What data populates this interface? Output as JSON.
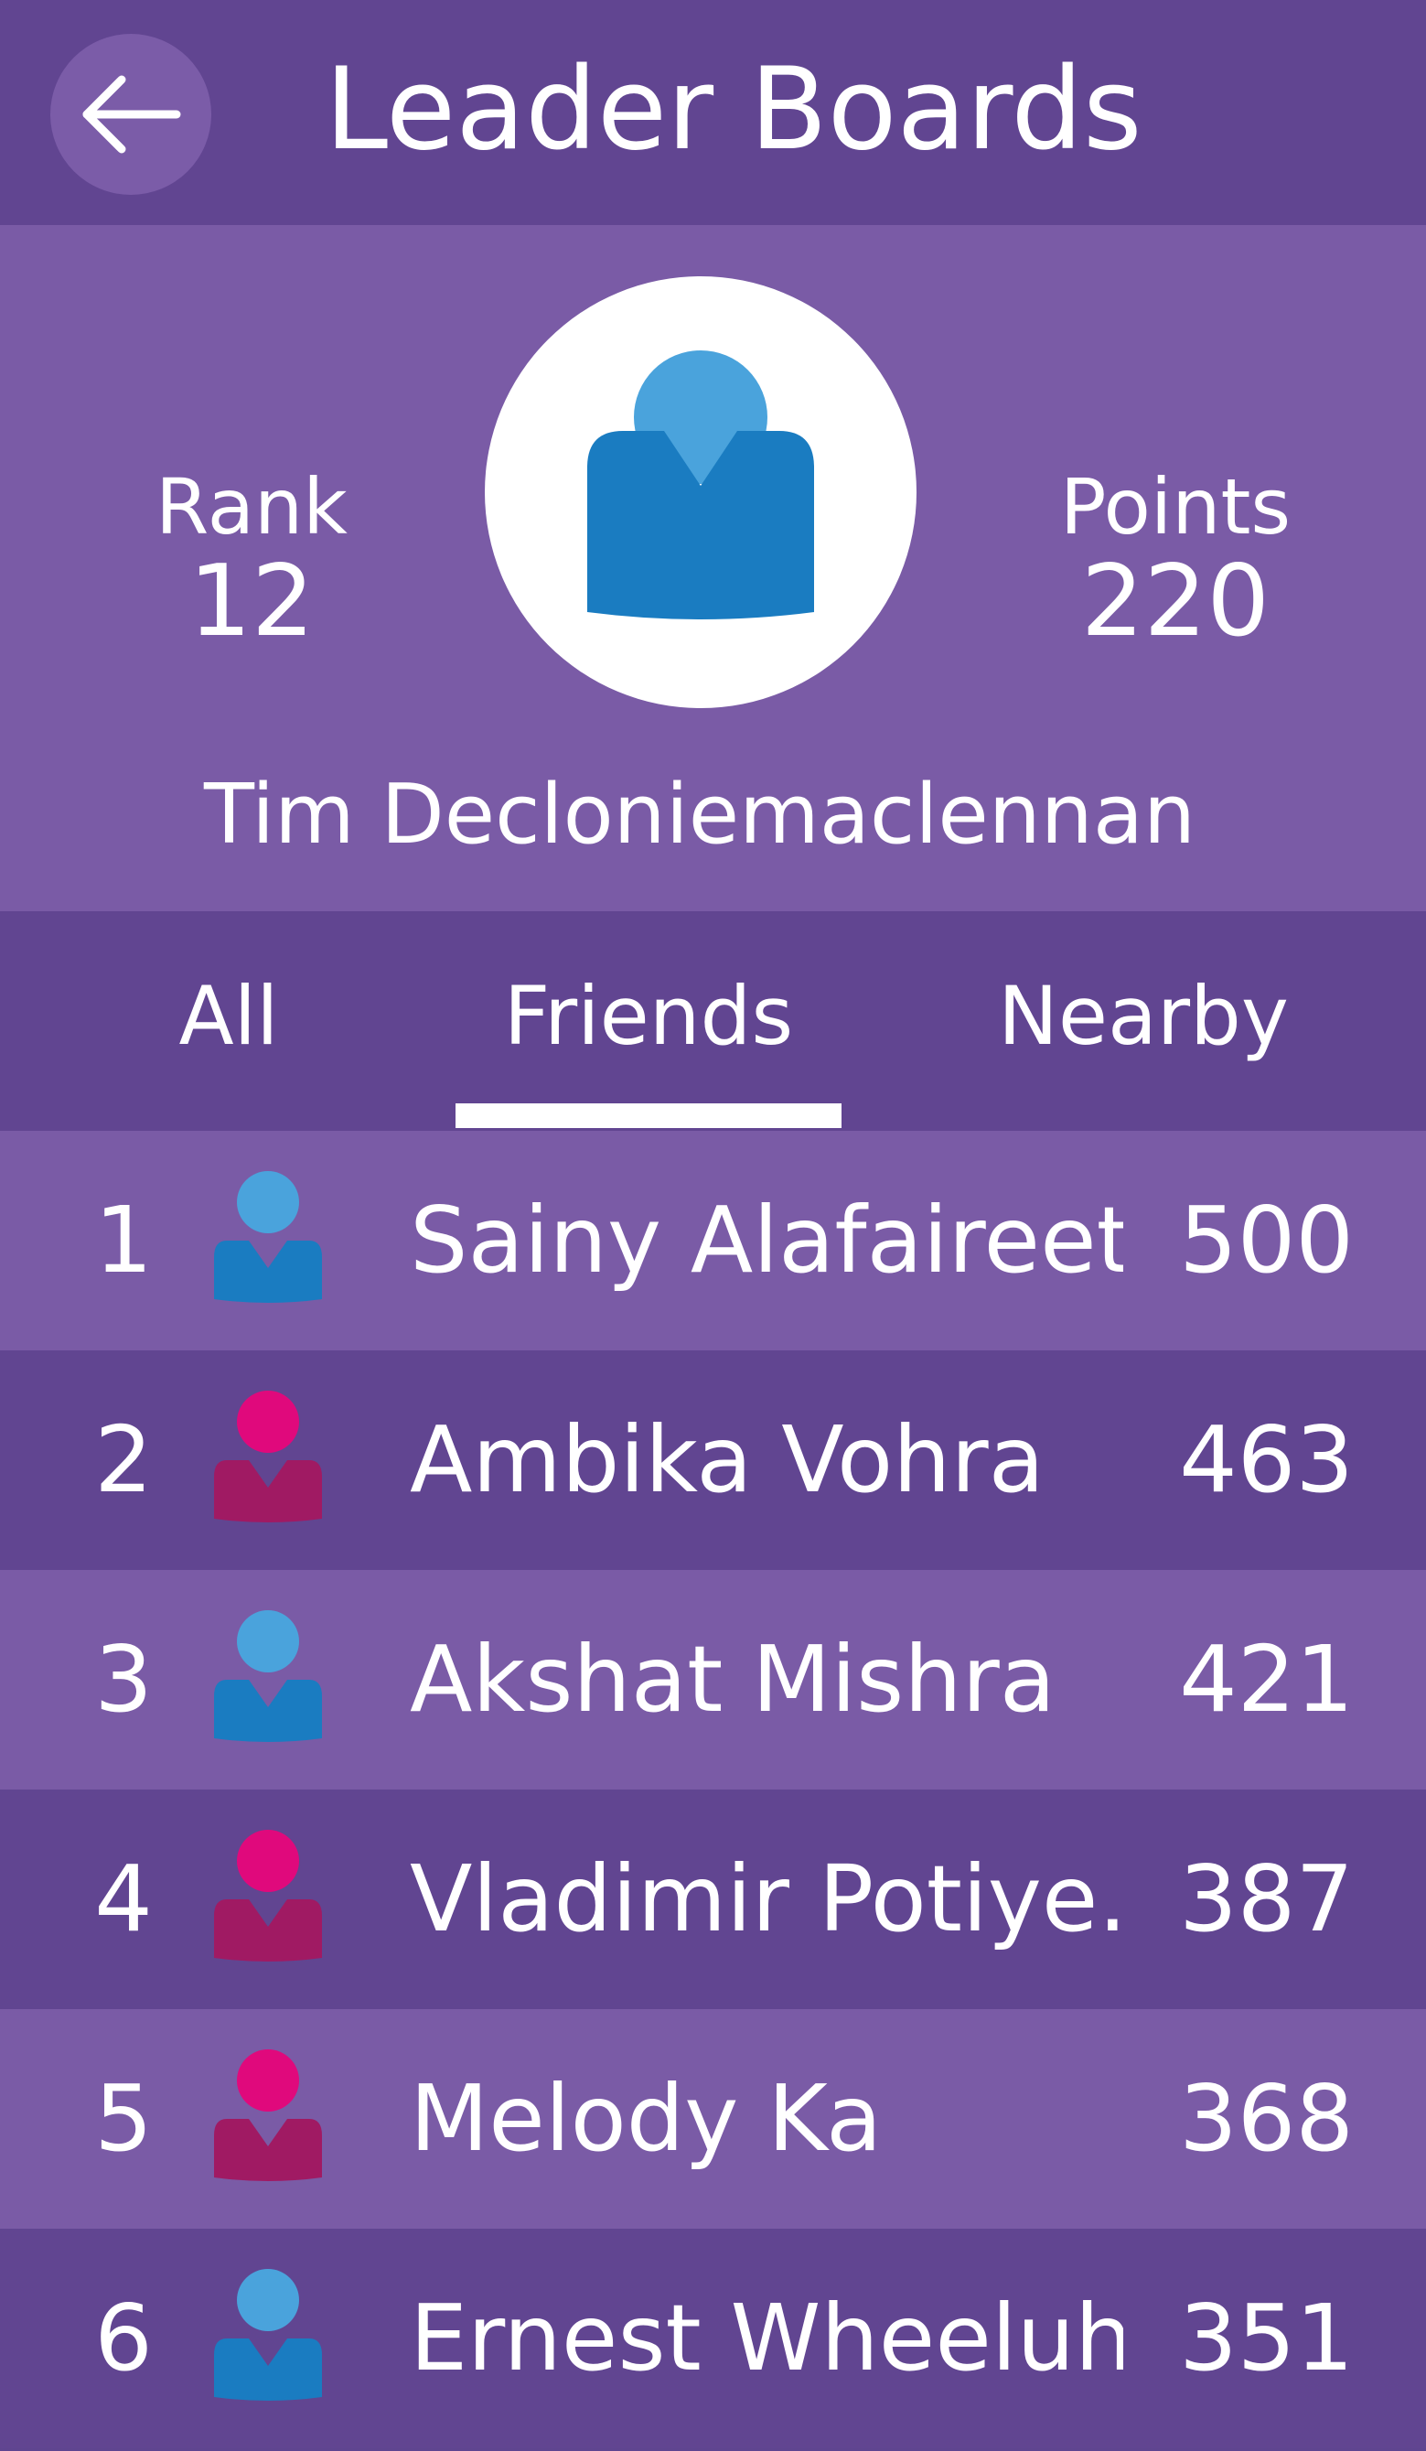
{
  "header": {
    "title": "Leader Boards",
    "back_icon": "arrow-left-icon"
  },
  "profile": {
    "rank_label": "Rank",
    "rank_value": "12",
    "points_label": "Points",
    "points_value": "220",
    "name": "Tim Decloniemaclennan",
    "avatar_icon": "user-avatar-icon",
    "avatar_color": "#1a7cc1"
  },
  "tabs": {
    "items": [
      "All",
      "Friends",
      "Nearby"
    ],
    "selected": "Friends"
  },
  "leaderboard": [
    {
      "rank": "1",
      "name": "Sainy Alafaireet",
      "points": "500",
      "avatar": "blue"
    },
    {
      "rank": "2",
      "name": "Ambika Vohra",
      "points": "463",
      "avatar": "magenta"
    },
    {
      "rank": "3",
      "name": "Akshat Mishra",
      "points": "421",
      "avatar": "blue"
    },
    {
      "rank": "4",
      "name": "Vladimir Potiye..",
      "points": "387",
      "avatar": "magenta"
    },
    {
      "rank": "5",
      "name": "Melody Ka",
      "points": "368",
      "avatar": "magenta"
    },
    {
      "rank": "6",
      "name": "Ernest Wheeluh",
      "points": "351",
      "avatar": "blue"
    }
  ],
  "colors": {
    "header_bg": "#614591",
    "panel_bg": "#7a5ba6",
    "avatar_blue_head": "#4aa3dc",
    "avatar_blue_body": "#1a7cc1",
    "avatar_magenta_head": "#e0097c",
    "avatar_magenta_body": "#a01a63"
  }
}
